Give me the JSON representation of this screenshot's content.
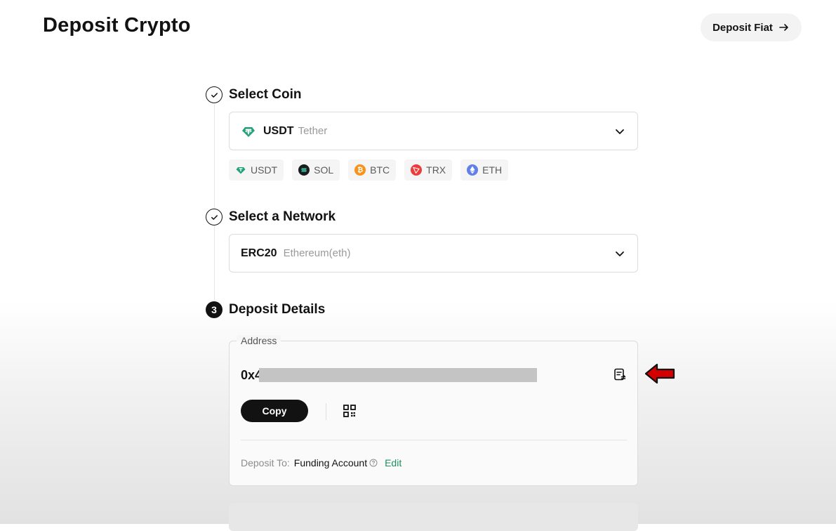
{
  "header": {
    "title": "Deposit Crypto",
    "deposit_fiat_label": "Deposit Fiat"
  },
  "steps": {
    "select_coin": {
      "title": "Select Coin",
      "selected_symbol": "USDT",
      "selected_name": "Tether",
      "quick_coins": [
        {
          "symbol": "USDT",
          "icon": "tether-icon",
          "color": "#26a17b"
        },
        {
          "symbol": "SOL",
          "icon": "solana-icon",
          "color": "#1c1c1c"
        },
        {
          "symbol": "BTC",
          "icon": "bitcoin-icon",
          "color": "#f7931a"
        },
        {
          "symbol": "TRX",
          "icon": "tron-icon",
          "color": "#ec3c3c"
        },
        {
          "symbol": "ETH",
          "icon": "ethereum-icon",
          "color": "#627eea"
        }
      ]
    },
    "select_network": {
      "title": "Select a Network",
      "selected_network": "ERC20",
      "selected_network_name": "Ethereum(eth)"
    },
    "deposit_details": {
      "number": "3",
      "title": "Deposit Details",
      "address_label": "Address",
      "address_prefix": "0x4",
      "copy_label": "Copy",
      "deposit_to_label": "Deposit To:",
      "deposit_to_value": "Funding Account",
      "edit_label": "Edit"
    }
  },
  "colors": {
    "accent_green": "#1e8f5e",
    "pointer_arrow": "#d40000"
  }
}
